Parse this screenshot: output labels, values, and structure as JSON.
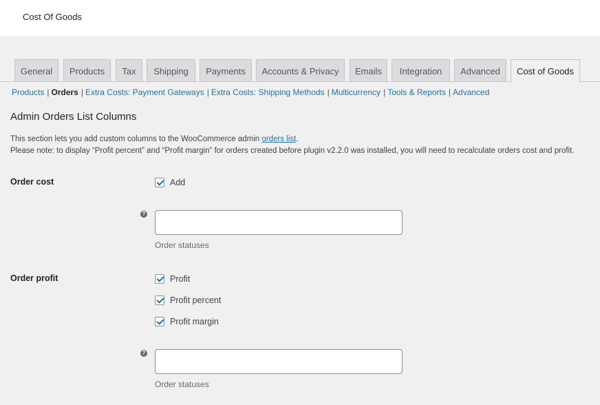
{
  "header": {
    "title": "Cost Of Goods"
  },
  "tabs": [
    {
      "label": "General"
    },
    {
      "label": "Products"
    },
    {
      "label": "Tax"
    },
    {
      "label": "Shipping"
    },
    {
      "label": "Payments"
    },
    {
      "label": "Accounts & Privacy"
    },
    {
      "label": "Emails"
    },
    {
      "label": "Integration"
    },
    {
      "label": "Advanced"
    },
    {
      "label": "Cost of Goods",
      "active": true
    }
  ],
  "subnav": [
    {
      "label": "Products",
      "current": false
    },
    {
      "label": "Orders",
      "current": true
    },
    {
      "label": "Extra Costs: Payment Gateways",
      "current": false
    },
    {
      "label": "Extra Costs: Shipping Methods",
      "current": false
    },
    {
      "label": "Multicurrency",
      "current": false
    },
    {
      "label": "Tools & Reports",
      "current": false
    },
    {
      "label": "Advanced",
      "current": false
    }
  ],
  "section": {
    "title": "Admin Orders List Columns",
    "desc_prefix": "This section lets you add custom columns to the WooCommerce admin ",
    "desc_link": "orders list",
    "desc_suffix": ".",
    "note": "Please note: to display “Profit percent” and “Profit margin” for orders created before plugin v2.2.0 was installed, you will need to recalculate orders cost and profit."
  },
  "order_cost": {
    "label": "Order cost",
    "checkbox_add": {
      "label": "Add",
      "checked": true
    },
    "statuses_value": "",
    "statuses_desc": "Order statuses"
  },
  "order_profit": {
    "label": "Order profit",
    "checkbox_profit": {
      "label": "Profit",
      "checked": true
    },
    "checkbox_percent": {
      "label": "Profit percent",
      "checked": true
    },
    "checkbox_margin": {
      "label": "Profit margin",
      "checked": true
    },
    "statuses_value": "",
    "statuses_desc": "Order statuses"
  },
  "icons": {
    "help": "?"
  },
  "colors": {
    "link": "#2271b1",
    "background": "#f0f0f1",
    "tab_inactive": "#dcdcde"
  }
}
